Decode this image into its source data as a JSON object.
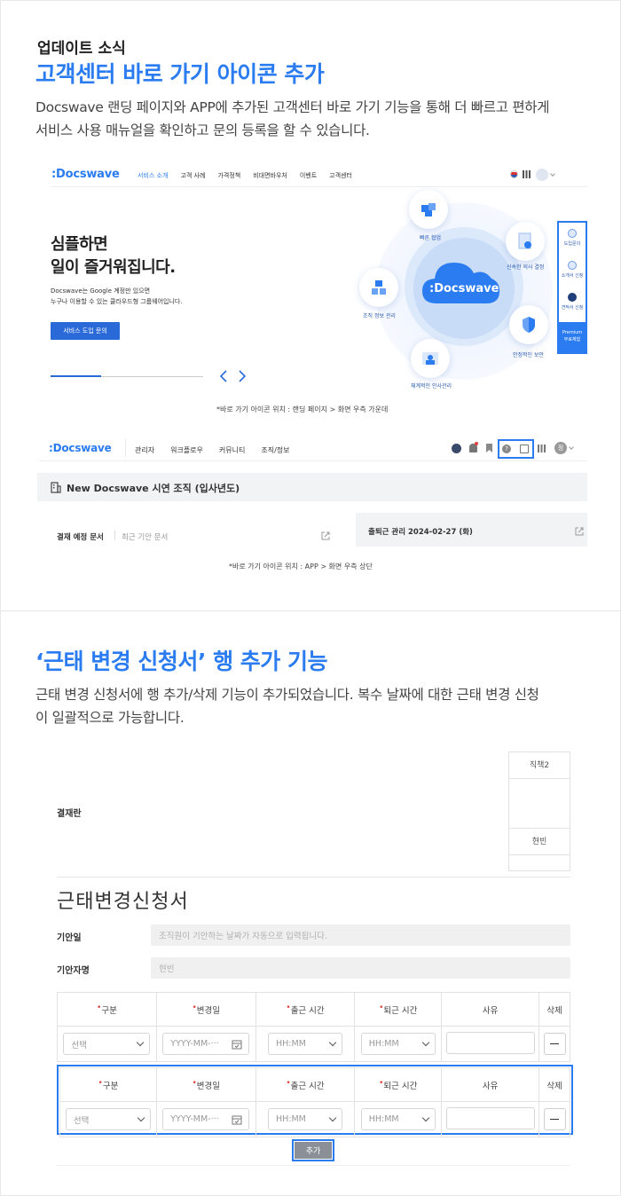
{
  "section1": {
    "eyebrow": "업데이트 소식",
    "title": "고객센터 바로 가기 아이콘 추가",
    "desc_line1": "Docswave 랜딩 페이지와 APP에 추가된 고객센터 바로 가기 기능을 통해 더 빠르고 편하게",
    "desc_line2": "서비스 사용 매뉴얼을 확인하고 문의 등록을 할 수 있습니다."
  },
  "landing": {
    "logo": ":Docswave",
    "nav": [
      "서비스 소개",
      "고객 사례",
      "가격정책",
      "비대면바우처",
      "이벤트",
      "고객센터"
    ],
    "hero_title_1": "심플하면",
    "hero_title_2": "일이 즐거워집니다.",
    "hero_sub_1": "Docswave는 Google 계정만 있으면",
    "hero_sub_2": "누구나 이용할 수 있는 클라우드형 그룹웨어입니다.",
    "hero_button": "서비스 도입 문의",
    "center_logo": ":Docswave",
    "bubbles": {
      "top": "빠른 협업",
      "right_top": "신속한 의사 결정",
      "left": "조직 정보 관리",
      "right_bottom": "안정적인 보안",
      "bottom": "체계적인 인사관리"
    },
    "sidebar": {
      "item1": "도입문의",
      "item2": "소개서 신청",
      "item3": "견적서 신청",
      "premium_1": "Premium",
      "premium_2": "무료체험"
    },
    "caption": "*바로 가기 아이콘 위치 : 랜딩 페이지 > 화면 우측 가운데"
  },
  "app": {
    "logo": ":Docswave",
    "nav": [
      "관리자",
      "워크플로우",
      "커뮤니티",
      "조직/정보"
    ],
    "org_title": "New Docswave 시연 조직 (입사년도)",
    "tab_active": "결재 예정 문서",
    "tab_other": "최근 기안 문서",
    "attendance": "출퇴근 관리 2024-02-27 (화)",
    "caption": "*바로 가기 아이콘 위치 :  APP > 화면 우측 상단",
    "avatar_letter": "정"
  },
  "section2": {
    "title": "‘근태 변경 신청서’ 행 추가 기능",
    "desc_line1": "근태 변경 신청서에 행 추가/삭제 기능이 추가되었습니다. 복수 날짜에 대한 근태 변경 신청",
    "desc_line2": "이 일괄적으로 가능합니다."
  },
  "form": {
    "approval_label": "결재란",
    "approver_role": "직책2",
    "approver_name": "현빈",
    "form_title": "근태변경신청서",
    "draft_date_label": "기안일",
    "draft_date_placeholder": "조직원이 기안하는 날짜가 자동으로 입력됩니다.",
    "drafter_label": "기안자명",
    "drafter_value": "현빈",
    "columns": [
      "구분",
      "변경일",
      "출근 시간",
      "퇴근 시간",
      "사유",
      "삭제"
    ],
    "required": "•",
    "row_select": "선택",
    "row_date": "YYYY-MM-···",
    "row_time": "HH:MM",
    "add_button": "추가"
  },
  "colors": {
    "accent": "#2a7cf0",
    "hero_button": "#2a6ad8",
    "add_button": "#8a8f98"
  }
}
